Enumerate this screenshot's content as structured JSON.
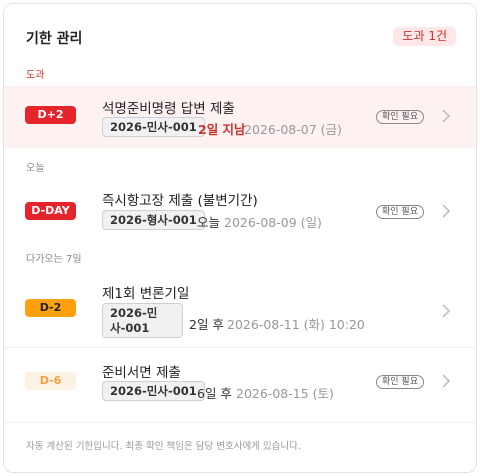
{
  "header": {
    "title": "기한 관리",
    "overdue_badge": "도과 1건"
  },
  "sections": {
    "overdue": "도과",
    "today": "오늘",
    "upcoming": "다가오는 7일"
  },
  "items": [
    {
      "dday": "D+2",
      "title": "석명준비명령 답변 제출",
      "case": "2026-민사-001",
      "relative": "2일 지남",
      "date": "2026-08-07 (금)",
      "badge": "확인 필요"
    },
    {
      "dday": "D-DAY",
      "title": "즉시항고장 제출 (불변기간)",
      "case": "2026-형사-001",
      "relative": "오늘",
      "date": "2026-08-09 (일)",
      "badge": "확인 필요"
    },
    {
      "dday": "D-2",
      "title": "제1회 변론기일",
      "case": "2026-민사-001",
      "relative": "2일 후",
      "date": "2026-08-11 (화) 10:20"
    },
    {
      "dday": "D-6",
      "title": "준비서면 제출",
      "case": "2026-민사-001",
      "relative": "6일 후",
      "date": "2026-08-15 (토)",
      "badge": "확인 필요"
    }
  ],
  "footer": "자동 계산된 기한입니다. 최종 확인 책임은 담당 변호사에게 있습니다.",
  "colors": {
    "overdue_red": "#e5242b",
    "highlight_bg": "#fdf1f1",
    "upcoming_orange": "#fca10c",
    "upcoming_pale": "#fdf1e4"
  }
}
